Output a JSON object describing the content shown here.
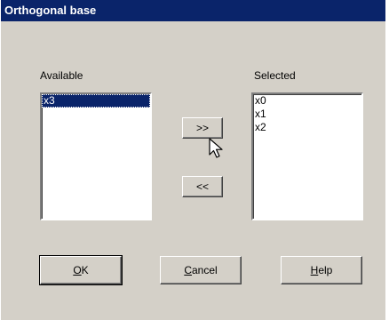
{
  "window": {
    "title": "Orthogonal base"
  },
  "available": {
    "label": "Available",
    "items": [
      "x3"
    ],
    "selected_index": 0
  },
  "selected": {
    "label": "Selected",
    "items": [
      "x0",
      "x1",
      "x2"
    ]
  },
  "buttons": {
    "add": ">>",
    "remove": "<<",
    "ok_mnemonic": "O",
    "ok_rest": "K",
    "cancel_mnemonic": "C",
    "cancel_rest": "ancel",
    "help_mnemonic": "H",
    "help_rest": "elp"
  },
  "colors": {
    "titlebar": "#0a246a",
    "dialog_bg": "#d4d0c8",
    "selection": "#0a246a"
  },
  "icons": {
    "cursor": "arrow-pointer-icon"
  }
}
